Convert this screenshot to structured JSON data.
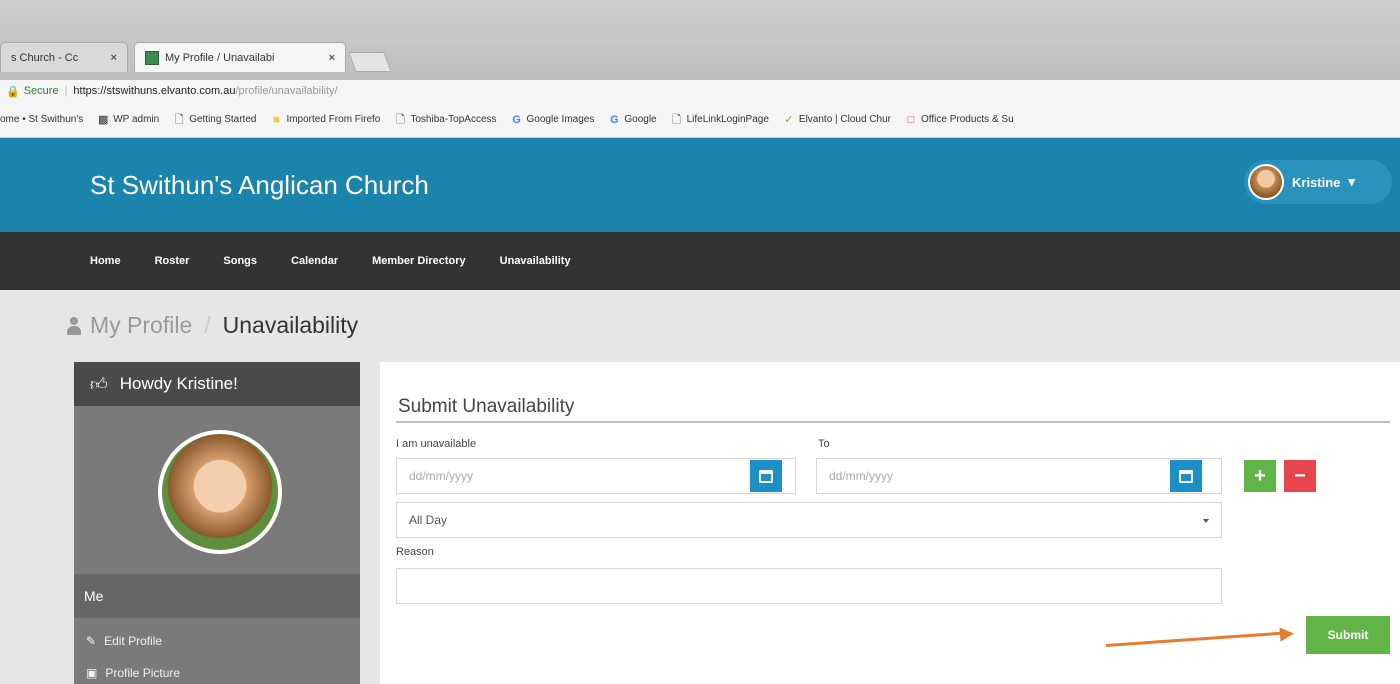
{
  "browser": {
    "tabs": [
      {
        "title": "s Church - Cc",
        "active": false
      },
      {
        "title": "My Profile / Unavailabi",
        "active": true
      }
    ],
    "close_glyph": "×",
    "address": {
      "secure_label": "Secure",
      "host": "https://stswithuns.elvanto.com.au",
      "path": "/profile/unavailability/"
    },
    "bookmarks": [
      {
        "label": "ome • St Swithun's",
        "icon": "page-icon"
      },
      {
        "label": "WP admin",
        "icon": "wp-icon"
      },
      {
        "label": "Getting Started",
        "icon": "page-icon"
      },
      {
        "label": "Imported From Firefo",
        "icon": "folder-icon"
      },
      {
        "label": "Toshiba-TopAccess",
        "icon": "page-icon"
      },
      {
        "label": "Google Images",
        "icon": "google-icon"
      },
      {
        "label": "Google",
        "icon": "google-icon"
      },
      {
        "label": "LifeLinkLoginPage",
        "icon": "page-icon"
      },
      {
        "label": "Elvanto | Cloud Chur",
        "icon": "elvanto-icon"
      },
      {
        "label": "Office Products & Su",
        "icon": "office-icon"
      }
    ]
  },
  "site": {
    "title": "St Swithun's Anglican Church",
    "user_name": "Kristine",
    "user_caret": "▾",
    "nav": [
      "Home",
      "Roster",
      "Songs",
      "Calendar",
      "Member Directory",
      "Unavailability"
    ]
  },
  "page": {
    "breadcrumb_parent": "My Profile",
    "breadcrumb_sep": "/",
    "breadcrumb_current": "Unavailability"
  },
  "sidebar": {
    "greeting": "Howdy Kristine!",
    "section_title": "Me",
    "links": [
      "Edit Profile",
      "Profile Picture"
    ]
  },
  "form": {
    "heading": "Submit Unavailability",
    "from_label": "I am unavailable",
    "to_label": "To",
    "date_placeholder": "dd/mm/yyyy",
    "time_option": "All Day",
    "reason_label": "Reason",
    "reason_value": "",
    "add_glyph": "+",
    "remove_glyph": "−",
    "submit_label": "Submit"
  },
  "colors": {
    "header_blue": "#1b84ad",
    "nav_dark": "#333333",
    "add_green": "#61b546",
    "remove_red": "#e5454b",
    "annotation_arrow": "#e57c2e"
  }
}
